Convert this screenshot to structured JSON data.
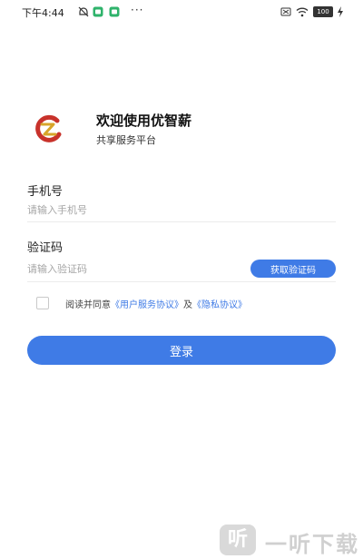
{
  "status_bar": {
    "time": "下午4:44",
    "more": "···",
    "battery": "100"
  },
  "welcome": {
    "title": "欢迎使用优智薪",
    "subtitle": "共享服务平台"
  },
  "form": {
    "phone": {
      "label": "手机号",
      "placeholder": "请输入手机号",
      "value": ""
    },
    "code": {
      "label": "验证码",
      "placeholder": "请输入验证码",
      "value": "",
      "button_label": "获取验证码"
    }
  },
  "agreement": {
    "prefix": "阅读并同意",
    "terms_link": "《用户服务协议》",
    "joiner": "及",
    "privacy_link": "《隐私协议》",
    "checked": false
  },
  "login_button_label": "登录",
  "watermark": {
    "badge": "听",
    "text": "一听下载"
  },
  "colors": {
    "accent": "#3f7be6",
    "logo_red": "#c8322b",
    "logo_gold": "#d7a52a"
  }
}
